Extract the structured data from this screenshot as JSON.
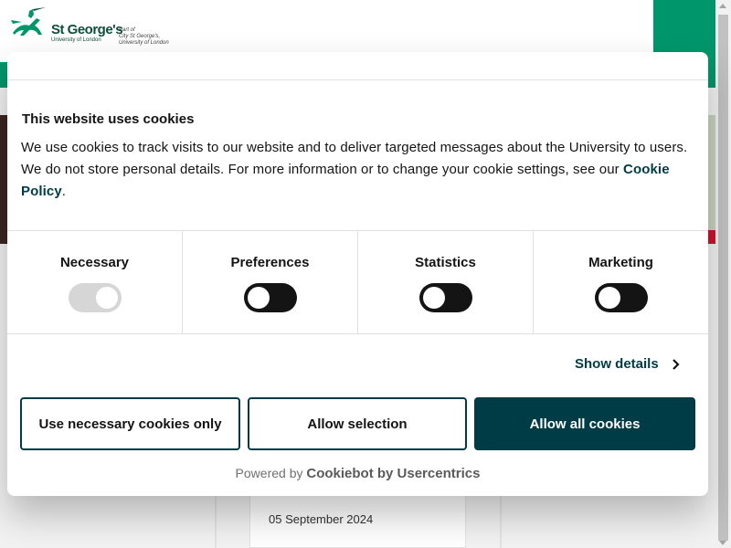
{
  "site": {
    "logo_name": "St George's",
    "logo_sub": "University of London",
    "logo_part_line1": "Part of",
    "logo_part_line2": "City St George's,",
    "logo_part_line3": "University of London",
    "card_date": "05 September 2024"
  },
  "dialog": {
    "title": "This website uses cookies",
    "body_text": "We use cookies to track visits to our website and to deliver targeted messages about the University to users. We do not store personal details. For more information or to change your cookie settings, see our ",
    "policy_link": "Cookie Policy",
    "body_end": ".",
    "categories": [
      {
        "label": "Necessary",
        "state": "on-disabled"
      },
      {
        "label": "Preferences",
        "state": "off"
      },
      {
        "label": "Statistics",
        "state": "off"
      },
      {
        "label": "Marketing",
        "state": "off"
      }
    ],
    "show_details": "Show details",
    "buttons": {
      "necessary": "Use necessary cookies only",
      "selection": "Allow selection",
      "all": "Allow all cookies"
    },
    "powered_prefix": "Powered by",
    "powered_brand": "Cookiebot by Usercentrics"
  },
  "colors": {
    "brand_green": "#00966b",
    "accent_dark": "#003c46",
    "toggle_off": "#141414",
    "toggle_disabled": "#d6d6d6"
  }
}
